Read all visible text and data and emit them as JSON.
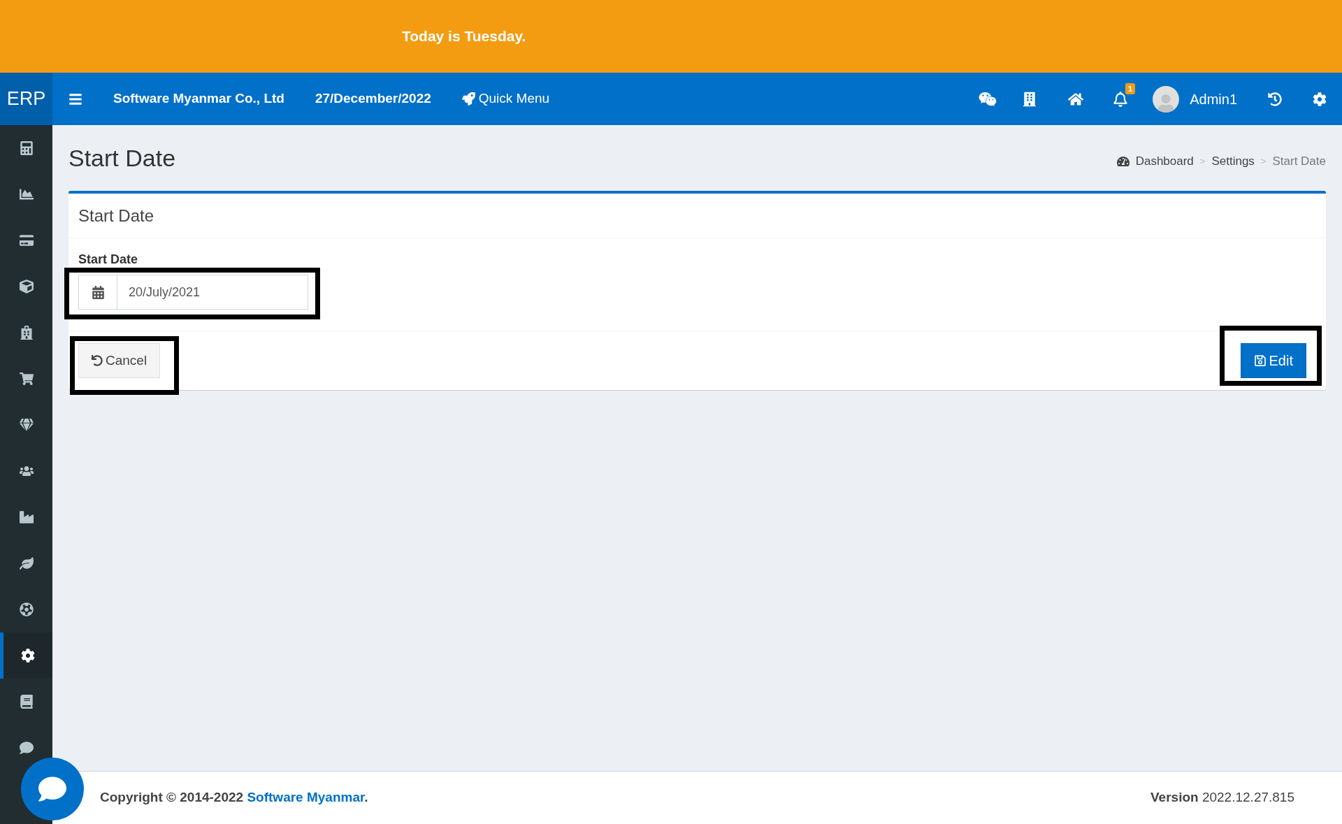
{
  "banner": {
    "text": "Today is Tuesday."
  },
  "navbar": {
    "logo": "ERP",
    "company": "Software Myanmar Co., Ltd",
    "date": "27/December/2022",
    "quick_menu": "Quick Menu",
    "notification_count": "1",
    "user": "Admin1"
  },
  "sidebar": {
    "items": [
      {
        "kind": "calculator",
        "selected": false
      },
      {
        "kind": "chart",
        "selected": false
      },
      {
        "kind": "card",
        "selected": false
      },
      {
        "kind": "cube",
        "selected": false
      },
      {
        "kind": "hospital",
        "selected": false
      },
      {
        "kind": "cart",
        "selected": false
      },
      {
        "kind": "gem",
        "selected": false
      },
      {
        "kind": "users",
        "selected": false
      },
      {
        "kind": "industry",
        "selected": false
      },
      {
        "kind": "leaf",
        "selected": false
      },
      {
        "kind": "ball",
        "selected": false
      },
      {
        "kind": "settings",
        "selected": true
      },
      {
        "kind": "book",
        "selected": false
      },
      {
        "kind": "comment",
        "selected": false
      }
    ]
  },
  "page": {
    "title": "Start Date",
    "breadcrumb": [
      {
        "label": "Dashboard",
        "current": false
      },
      {
        "label": "Settings",
        "current": false
      },
      {
        "label": "Start Date",
        "current": true
      }
    ],
    "separator": ">"
  },
  "card": {
    "title": "Start Date",
    "field_label": "Start Date",
    "field_value": "20/July/2021",
    "cancel": "Cancel",
    "edit": "Edit"
  },
  "footer": {
    "copyright": "Copyright © 2014-2022",
    "company_link": "Software Myanmar",
    "period": ".",
    "version_label": "Version",
    "version": "2022.12.27.815"
  }
}
